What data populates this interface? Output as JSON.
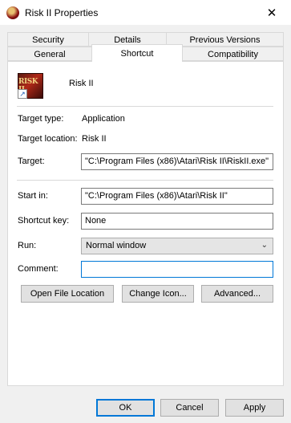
{
  "window": {
    "title": "Risk II Properties",
    "close_glyph": "✕",
    "icon": "risk-ii-app-icon"
  },
  "tabs": {
    "row1": [
      "Security",
      "Details",
      "Previous Versions"
    ],
    "row2": [
      "General",
      "Shortcut",
      "Compatibility"
    ],
    "active": "Shortcut"
  },
  "shortcut": {
    "name": "Risk II",
    "icon_text": "RISK II",
    "overlay_glyph": "↗",
    "target_type_label": "Target type:",
    "target_type": "Application",
    "target_location_label": "Target location:",
    "target_location": "Risk II",
    "target_label": "Target:",
    "target": "\"C:\\Program Files (x86)\\Atari\\Risk II\\RiskII.exe\"",
    "start_in_label": "Start in:",
    "start_in": "\"C:\\Program Files (x86)\\Atari\\Risk II\"",
    "shortcut_key_label": "Shortcut key:",
    "shortcut_key": "None",
    "run_label": "Run:",
    "run": "Normal window",
    "comment_label": "Comment:",
    "comment": ""
  },
  "buttons": {
    "open_file_location": "Open File Location",
    "change_icon": "Change Icon...",
    "advanced": "Advanced...",
    "ok": "OK",
    "cancel": "Cancel",
    "apply": "Apply"
  }
}
